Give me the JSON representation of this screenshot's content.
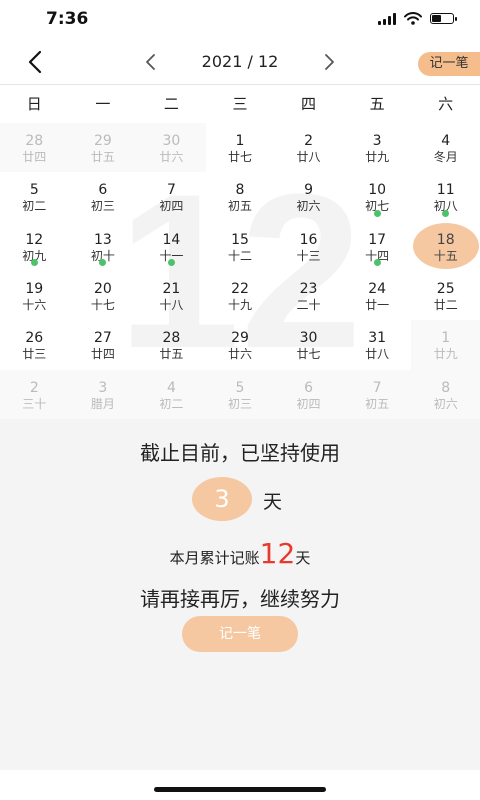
{
  "status_bar": {
    "time": "7:36",
    "battery_level": 0.45
  },
  "nav": {
    "title": "2021 / 12",
    "add_label": "记一笔"
  },
  "weekdays": [
    "日",
    "一",
    "二",
    "三",
    "四",
    "五",
    "六"
  ],
  "watermark": "12",
  "calendar": {
    "days": [
      {
        "day": "28",
        "lunar": "廿四",
        "out": true
      },
      {
        "day": "29",
        "lunar": "廿五",
        "out": true
      },
      {
        "day": "30",
        "lunar": "廿六",
        "out": true
      },
      {
        "day": "1",
        "lunar": "廿七"
      },
      {
        "day": "2",
        "lunar": "廿八"
      },
      {
        "day": "3",
        "lunar": "廿九"
      },
      {
        "day": "4",
        "lunar": "冬月"
      },
      {
        "day": "5",
        "lunar": "初二"
      },
      {
        "day": "6",
        "lunar": "初三"
      },
      {
        "day": "7",
        "lunar": "初四"
      },
      {
        "day": "8",
        "lunar": "初五"
      },
      {
        "day": "9",
        "lunar": "初六"
      },
      {
        "day": "10",
        "lunar": "初七",
        "dot": true
      },
      {
        "day": "11",
        "lunar": "初八",
        "dot": true
      },
      {
        "day": "12",
        "lunar": "初九",
        "dot": true
      },
      {
        "day": "13",
        "lunar": "初十",
        "dot": true
      },
      {
        "day": "14",
        "lunar": "十一",
        "dot": true
      },
      {
        "day": "15",
        "lunar": "十二"
      },
      {
        "day": "16",
        "lunar": "十三"
      },
      {
        "day": "17",
        "lunar": "十四",
        "dot": true
      },
      {
        "day": "18",
        "lunar": "十五",
        "today": true
      },
      {
        "day": "19",
        "lunar": "十六"
      },
      {
        "day": "20",
        "lunar": "十七"
      },
      {
        "day": "21",
        "lunar": "十八"
      },
      {
        "day": "22",
        "lunar": "十九"
      },
      {
        "day": "23",
        "lunar": "二十"
      },
      {
        "day": "24",
        "lunar": "廿一"
      },
      {
        "day": "25",
        "lunar": "廿二"
      },
      {
        "day": "26",
        "lunar": "廿三"
      },
      {
        "day": "27",
        "lunar": "廿四"
      },
      {
        "day": "28",
        "lunar": "廿五"
      },
      {
        "day": "29",
        "lunar": "廿六"
      },
      {
        "day": "30",
        "lunar": "廿七"
      },
      {
        "day": "31",
        "lunar": "廿八"
      },
      {
        "day": "1",
        "lunar": "廿九",
        "out": true
      },
      {
        "day": "2",
        "lunar": "三十",
        "out": true
      },
      {
        "day": "3",
        "lunar": "腊月",
        "out": true
      },
      {
        "day": "4",
        "lunar": "初二",
        "out": true
      },
      {
        "day": "5",
        "lunar": "初三",
        "out": true
      },
      {
        "day": "6",
        "lunar": "初四",
        "out": true
      },
      {
        "day": "7",
        "lunar": "初五",
        "out": true
      },
      {
        "day": "8",
        "lunar": "初六",
        "out": true
      }
    ]
  },
  "summary": {
    "title": "截止目前，已坚持使用",
    "days_count": "3",
    "days_unit": "天",
    "month_label": "本月累计记账",
    "month_count": "12",
    "month_unit": "天",
    "encourage": "请再接再厉，继续努力",
    "add_button": "记一笔"
  },
  "colors": {
    "accent": "#f5c8a2",
    "accent_dark": "#f5bd8c",
    "count_red": "#e8392d",
    "dot_green": "#4cc36a"
  }
}
